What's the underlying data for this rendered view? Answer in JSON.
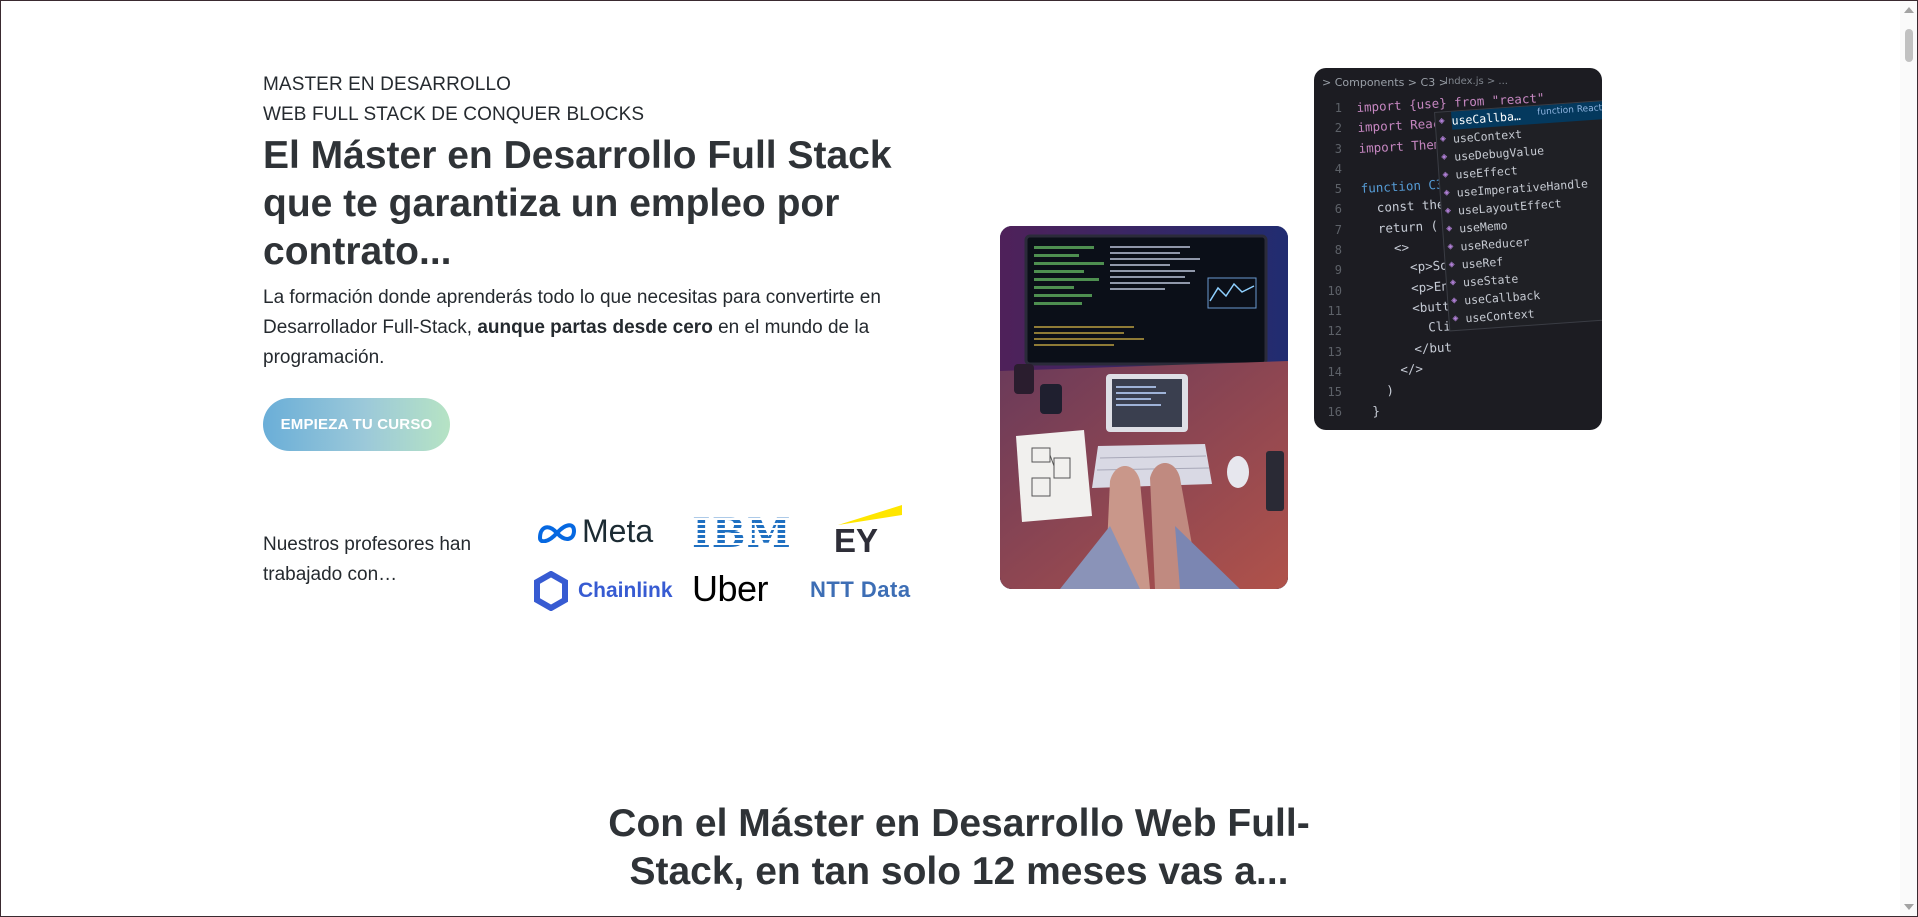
{
  "hero": {
    "eyebrow_line1": "MASTER EN DESARROLLO",
    "eyebrow_line2": "WEB FULL STACK DE CONQUER BLOCKS",
    "title": "El Máster en Desarrollo Full Stack que te garantiza un empleo por contrato...",
    "text_part1": "La formación donde aprenderás todo lo que necesitas para convertirte en Desarrollador Full-Stack, ",
    "text_bold": "aunque partas desde cero",
    "text_part2": " en el mundo de la programación.",
    "cta_label": "EMPIEZA TU CURSO"
  },
  "professors": {
    "text": "Nuestros profesores han trabajado con…",
    "logos": {
      "meta": "Meta",
      "ibm": "IBM",
      "ey": "EY",
      "chainlink": "Chainlink",
      "uber": "Uber",
      "ntt": "NTT Data"
    }
  },
  "code_image": {
    "breadcrumb": "> Components > C3 >",
    "file": "Index.js > ...",
    "line_numbers": [
      "1",
      "2",
      "3",
      "4",
      "5",
      "6",
      "7",
      "8",
      "9",
      "10",
      "11",
      "12",
      "13",
      "14",
      "15",
      "16"
    ],
    "code_lines": [
      "import {use} from \"react\"",
      "import Reac",
      "import Them",
      "",
      "function C3",
      "  const the",
      "  return (",
      "    <>",
      "      <p>So",
      "      <p>En",
      "      <butt",
      "        Cli",
      "      </but",
      "    </>",
      "  )",
      "}"
    ],
    "suggestions": [
      "useCallba…",
      "useContext",
      "useDebugValue",
      "useEffect",
      "useImperativeHandle",
      "useLayoutEffect",
      "useMemo",
      "useReducer",
      "useRef",
      "useState",
      "useCallback",
      "useContext"
    ],
    "suggestion_detail": "function React"
  },
  "section": {
    "title": "Con el Máster en Desarrollo Web Full-Stack, en tan solo 12 meses vas a..."
  },
  "colors": {
    "cta_gradient_start": "#6aaed8",
    "cta_gradient_end": "#b6e3c4",
    "heading": "#2f3337"
  }
}
